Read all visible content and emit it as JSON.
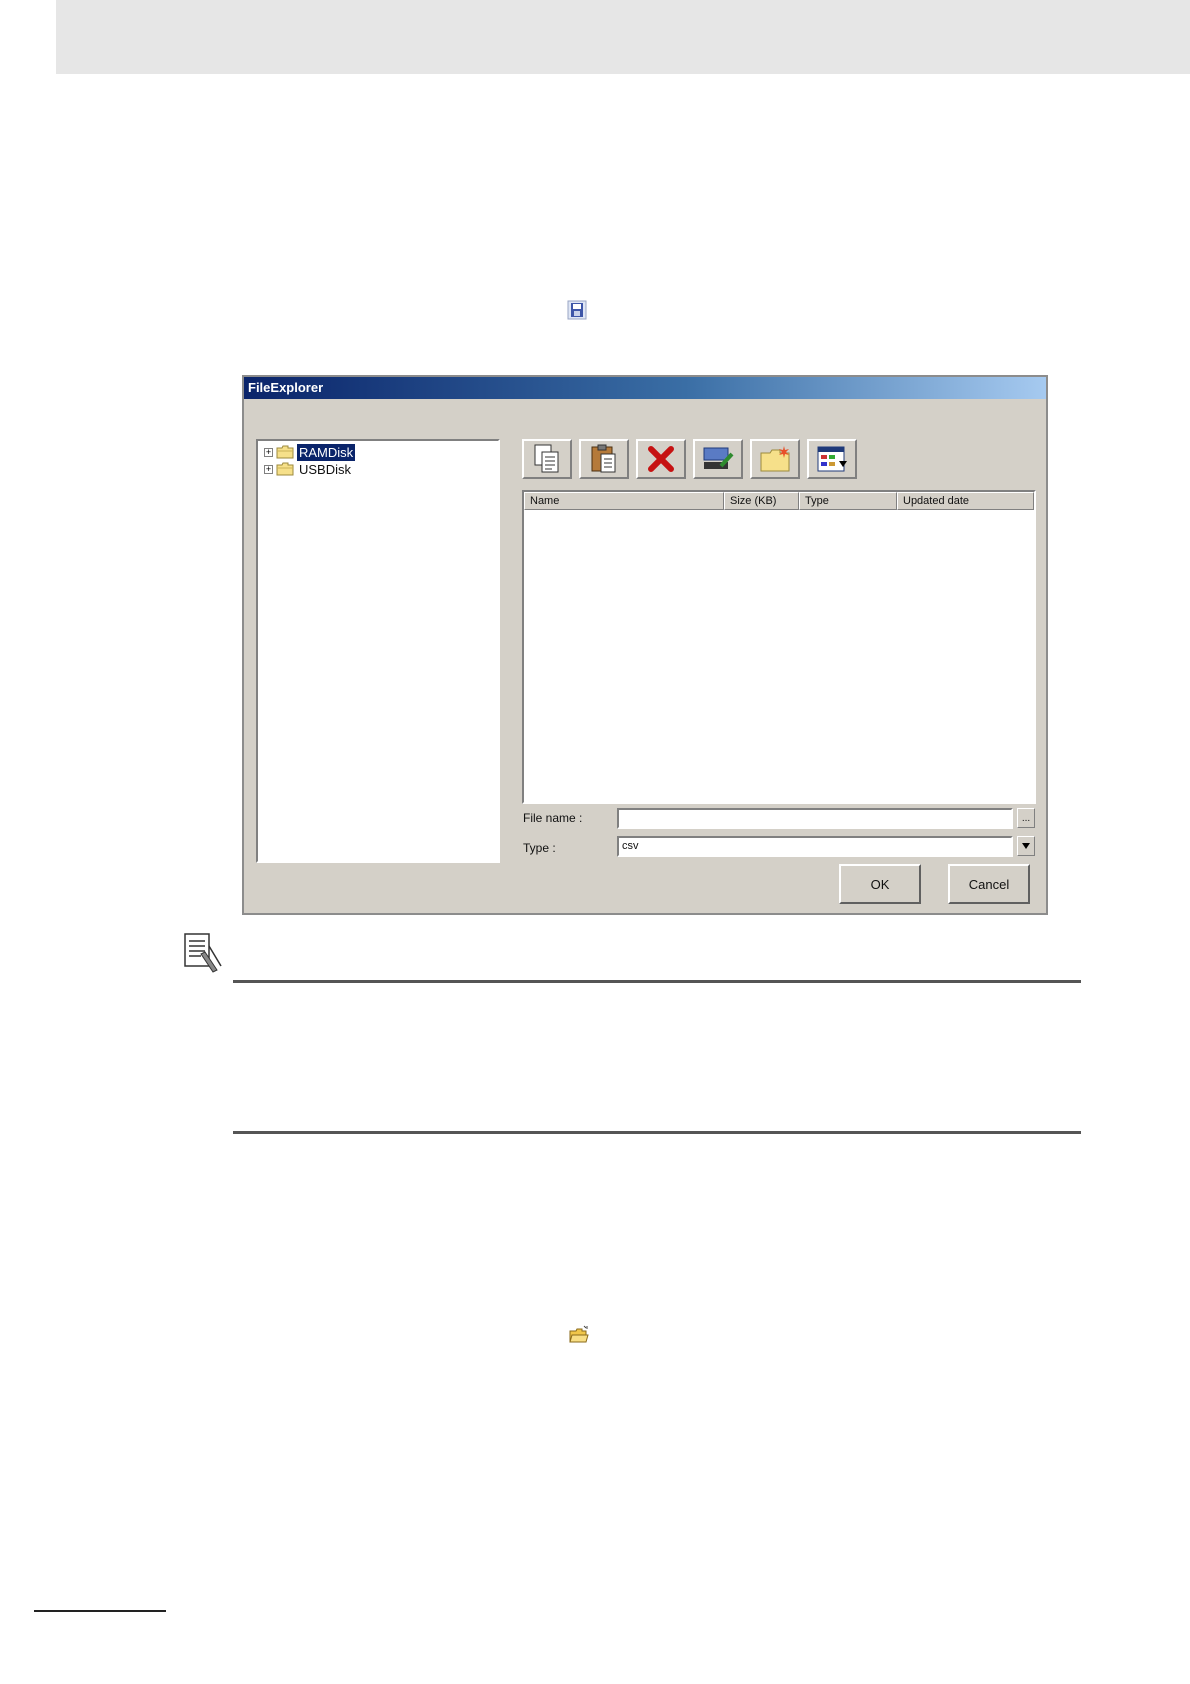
{
  "dialog": {
    "title": "FileExplorer",
    "tree": [
      {
        "label": "RAMDisk",
        "selected": true,
        "icon": "folder-icon"
      },
      {
        "label": "USBDisk",
        "selected": false,
        "icon": "folder-icon"
      }
    ],
    "toolbar": [
      {
        "name": "copy",
        "icon": "copy-icon"
      },
      {
        "name": "paste",
        "icon": "paste-icon"
      },
      {
        "name": "delete",
        "icon": "delete-icon"
      },
      {
        "name": "rename",
        "icon": "rename-icon"
      },
      {
        "name": "new-folder",
        "icon": "new-folder-icon"
      },
      {
        "name": "view",
        "icon": "view-icon"
      }
    ],
    "list_columns": [
      "Name",
      "Size (KB)",
      "Type",
      "Updated date"
    ],
    "file_name_label": "File name :",
    "file_name_value": "",
    "browse_label": "...",
    "type_label": "Type :",
    "type_value": "csv",
    "ok_label": "OK",
    "cancel_label": "Cancel"
  },
  "icons": {
    "inline_save": "save-icon",
    "inline_open": "open-folder-icon",
    "note": "additional-information-icon"
  }
}
